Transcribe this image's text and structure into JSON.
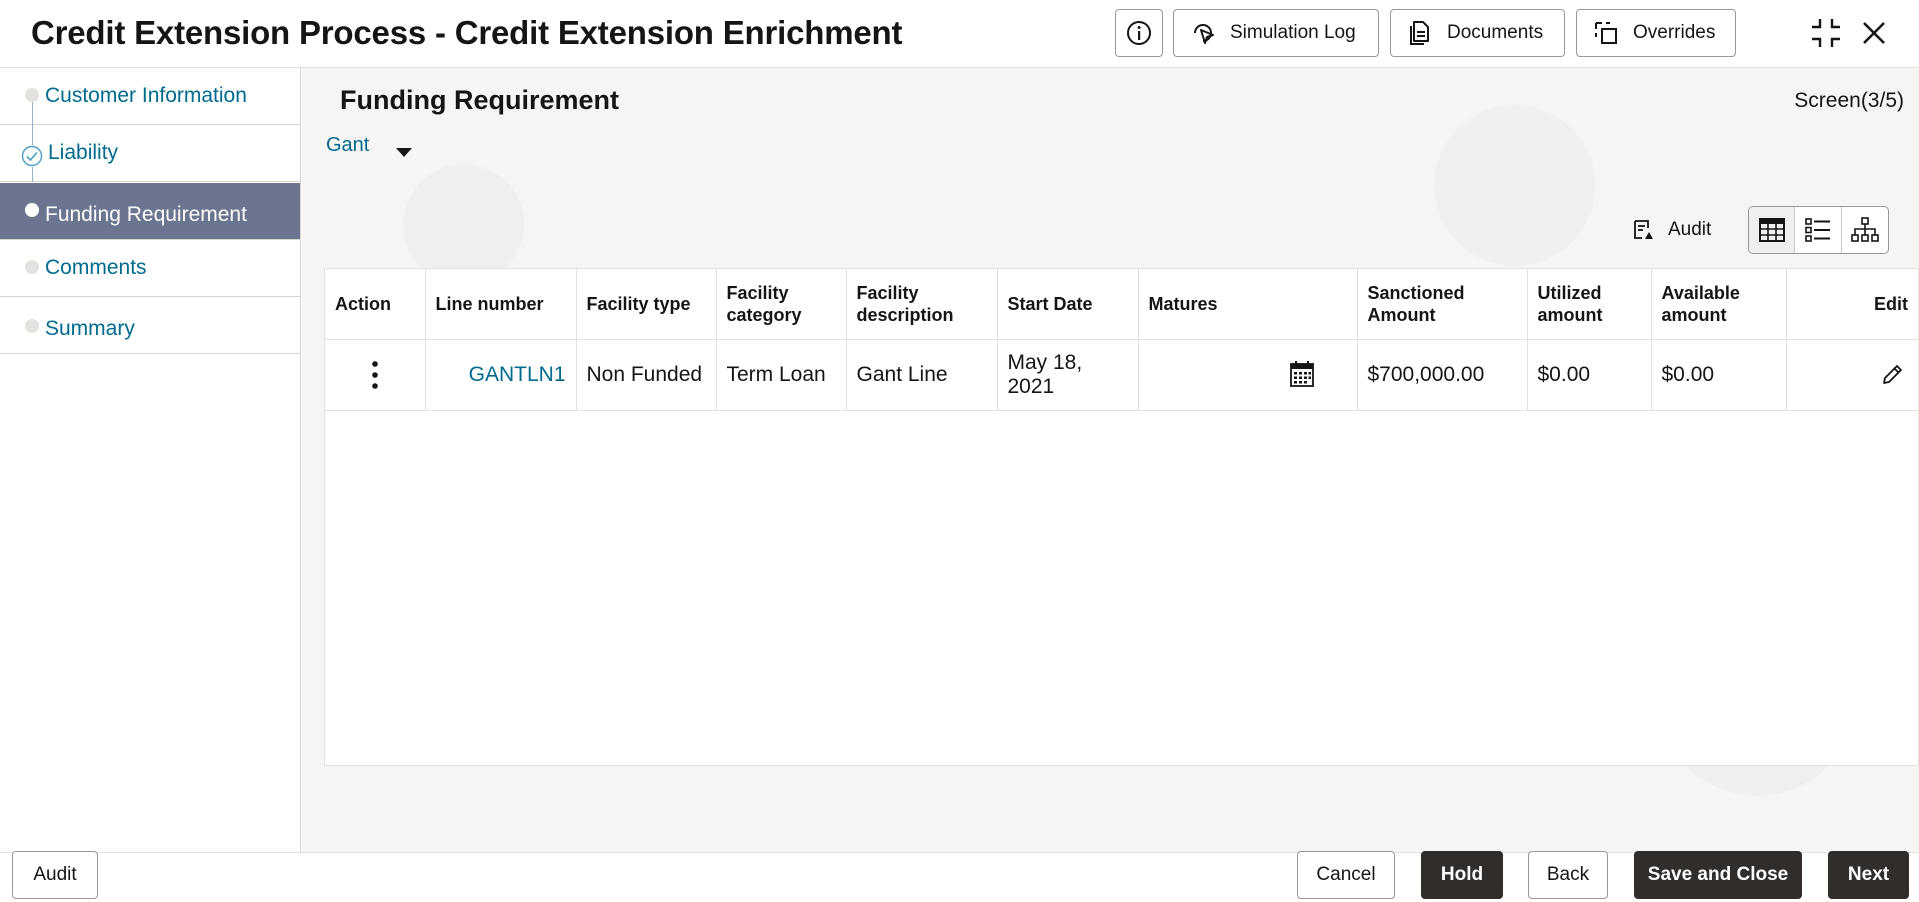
{
  "header": {
    "title": "Credit Extension Process - Credit Extension Enrichment",
    "buttons": {
      "simulation_log": "Simulation Log",
      "documents": "Documents",
      "overrides": "Overrides"
    }
  },
  "sidebar": {
    "items": [
      {
        "label": "Customer Information",
        "state": "pending"
      },
      {
        "label": "Liability",
        "state": "done"
      },
      {
        "label": "Funding Requirement",
        "state": "active"
      },
      {
        "label": "Comments",
        "state": "pending"
      },
      {
        "label": "Summary",
        "state": "pending"
      }
    ]
  },
  "main": {
    "title": "Funding Requirement",
    "screen_count": "Screen(3/5)",
    "selector_value": "Gant",
    "audit_label": "Audit"
  },
  "table": {
    "headers": [
      "Action",
      "Line number",
      "Facility type",
      "Facility category",
      "Facility description",
      "Start Date",
      "Matures",
      "Sanctioned Amount",
      "Utilized amount",
      "Available amount",
      "Edit"
    ],
    "rows": [
      {
        "line_number": "GANTLN1",
        "facility_type": "Non Funded",
        "facility_category": "Term Loan",
        "facility_description": "Gant Line",
        "start_date": "May 18, 2021",
        "matures": "",
        "sanctioned_amount": "$700,000.00",
        "utilized_amount": "$0.00",
        "available_amount": "$0.00"
      }
    ]
  },
  "footer": {
    "audit": "Audit",
    "cancel": "Cancel",
    "hold": "Hold",
    "back": "Back",
    "save_and_close": "Save and Close",
    "next": "Next"
  },
  "colors": {
    "link": "#006b8f",
    "active_step": "#6b7590",
    "dark_button": "#312d2a"
  }
}
